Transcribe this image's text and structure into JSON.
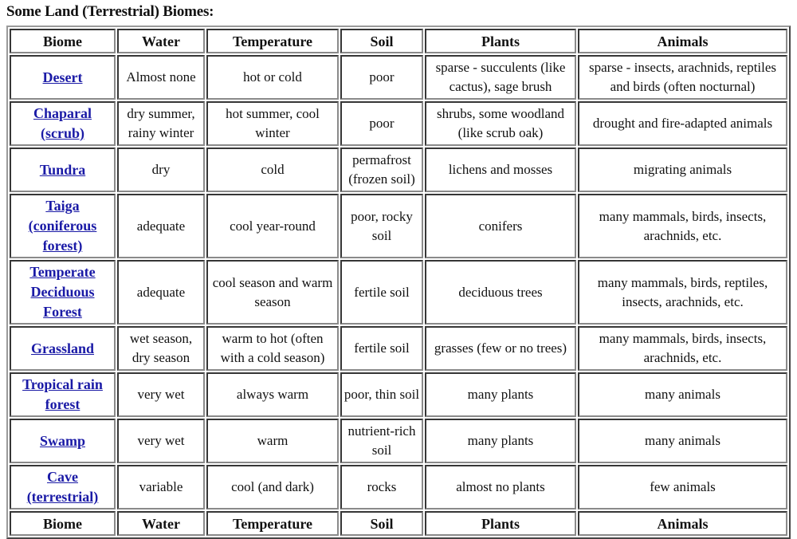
{
  "title": "Some Land (Terrestrial) Biomes:",
  "link_color": "#1a1aa6",
  "columns": [
    "Biome",
    "Water",
    "Temperature",
    "Soil",
    "Plants",
    "Animals"
  ],
  "rows": [
    {
      "biome": "Desert",
      "water": "Almost none",
      "temperature": "hot or cold",
      "soil": "poor",
      "plants": "sparse - succulents (like cactus), sage brush",
      "animals": "sparse - insects, arachnids, reptiles and birds (often nocturnal)"
    },
    {
      "biome": "Chaparal (scrub)",
      "water": "dry summer, rainy winter",
      "temperature": "hot summer, cool winter",
      "soil": "poor",
      "plants": "shrubs, some woodland (like scrub oak)",
      "animals": "drought and fire-adapted animals"
    },
    {
      "biome": "Tundra",
      "water": "dry",
      "temperature": "cold",
      "soil": "permafrost (frozen soil)",
      "plants": "lichens and mosses",
      "animals": "migrating animals"
    },
    {
      "biome": "Taiga (coniferous forest)",
      "water": "adequate",
      "temperature": "cool year-round",
      "soil": "poor, rocky soil",
      "plants": "conifers",
      "animals": "many mammals, birds, insects, arachnids, etc."
    },
    {
      "biome": "Temperate Deciduous Forest",
      "water": "adequate",
      "temperature": "cool season and warm season",
      "soil": "fertile soil",
      "plants": "deciduous trees",
      "animals": "many mammals, birds, reptiles, insects, arachnids, etc."
    },
    {
      "biome": "Grassland",
      "water": "wet season, dry season",
      "temperature": "warm to hot (often with a cold season)",
      "soil": "fertile soil",
      "plants": "grasses (few or no trees)",
      "animals": "many mammals, birds, insects, arachnids, etc."
    },
    {
      "biome": "Tropical rain forest",
      "water": "very wet",
      "temperature": "always warm",
      "soil": "poor, thin soil",
      "plants": "many plants",
      "animals": "many animals"
    },
    {
      "biome": "Swamp",
      "water": "very wet",
      "temperature": "warm",
      "soil": "nutrient-rich soil",
      "plants": "many plants",
      "animals": "many animals"
    },
    {
      "biome": "Cave (terrestrial)",
      "water": "variable",
      "temperature": "cool (and dark)",
      "soil": "rocks",
      "plants": "almost no plants",
      "animals": "few animals"
    }
  ],
  "footer_columns": [
    "Biome",
    "Water",
    "Temperature",
    "Soil",
    "Plants",
    "Animals"
  ]
}
